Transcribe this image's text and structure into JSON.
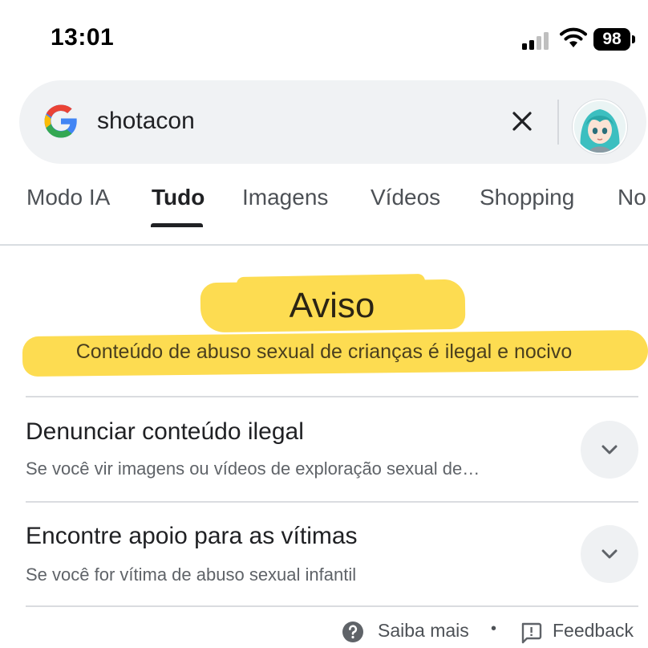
{
  "status_bar": {
    "time": "13:01",
    "battery": "98"
  },
  "search": {
    "query": "shotacon"
  },
  "tabs": [
    {
      "label": "Modo IA"
    },
    {
      "label": "Tudo",
      "active": true
    },
    {
      "label": "Imagens"
    },
    {
      "label": "Vídeos"
    },
    {
      "label": "Shopping"
    },
    {
      "label": "No"
    }
  ],
  "warning": {
    "title": "Aviso",
    "subtitle": "Conteúdo de abuso sexual de crianças é ilegal e nocivo"
  },
  "items": [
    {
      "title": "Denunciar conteúdo ilegal",
      "description": "Se você vir imagens ou vídeos de exploração sexual de…"
    },
    {
      "title": "Encontre apoio para as vítimas",
      "description": "Se você for vítima de abuso sexual infantil"
    }
  ],
  "footer": {
    "learn_more": "Saiba mais",
    "separator": "•",
    "feedback": "Feedback"
  },
  "colors": {
    "highlight": "#fddc51",
    "search_bg": "#f0f2f4",
    "text": "#202124"
  },
  "icons": [
    "google-logo-icon",
    "close-icon",
    "chevron-down-icon",
    "help-icon",
    "feedback-icon",
    "wifi-icon",
    "signal-icon",
    "battery-icon"
  ]
}
